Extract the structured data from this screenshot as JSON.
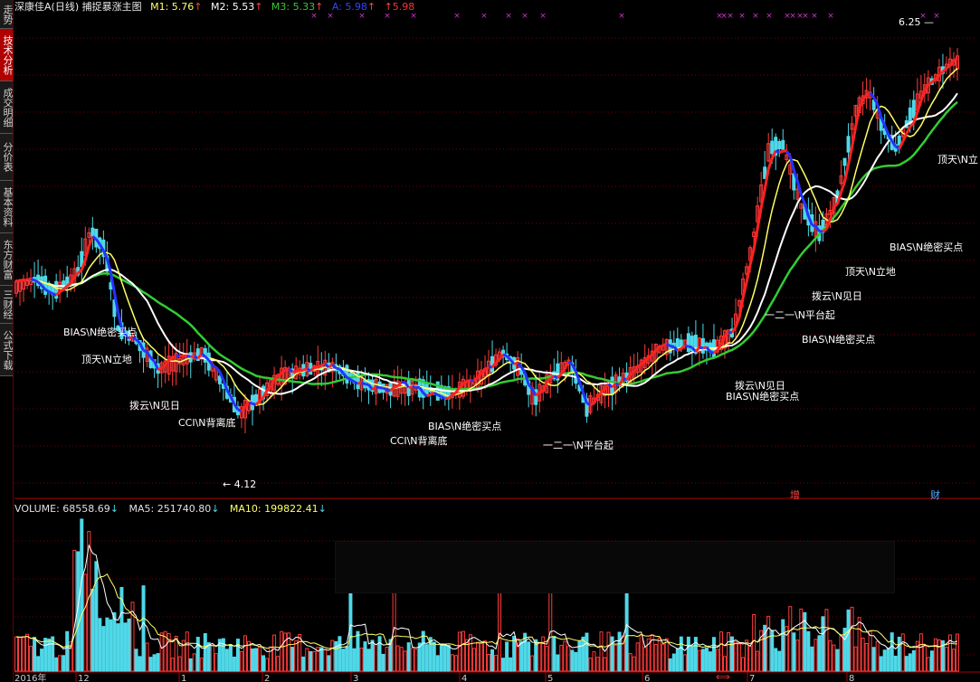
{
  "sidebar": {
    "tabs": [
      {
        "label": "走势",
        "active": false
      },
      {
        "label": "技术分析",
        "active": true
      },
      {
        "label": "成交明细",
        "active": false
      },
      {
        "label": "分价表",
        "active": false
      },
      {
        "label": "基本资料",
        "active": false
      },
      {
        "label": "东方财富",
        "active": false
      },
      {
        "label": "三财经",
        "active": false
      },
      {
        "label": "公式下载",
        "active": false
      }
    ]
  },
  "header": {
    "title": "深康佳A(日线) 捕捉暴涨主图",
    "m1": "M1: 5.76",
    "m2": "M2: 5.53",
    "m3": "M3: 5.33",
    "a": "A: 5.98",
    "b": "5.98",
    "arrow": "↑"
  },
  "volume_header": {
    "volume": "VOLUME: 68558.69",
    "ma5": "MA5: 251740.80",
    "ma10": "MA10: 199822.41",
    "arrow": "↓"
  },
  "colors": {
    "up": "#ff3b3b",
    "down": "#4fd8e8",
    "m1": "#ffff66",
    "m2": "#ffffff",
    "m3": "#33cc33",
    "signal": "#cc33cc",
    "grid": "#7a0000"
  },
  "chart_data": {
    "type": "candlestick",
    "price_range": [
      4.0,
      6.35
    ],
    "high_label": "6.25",
    "low_label": "4.12",
    "x_axis_labels": [
      "2016年",
      "12",
      "1",
      "2",
      "3",
      "4",
      "5",
      "6",
      "7",
      "8"
    ],
    "annotations": [
      "BIAS\\N绝密买点",
      "顶天\\N立地",
      "拨云\\N见日",
      "CCI\\N背离底",
      "CCI\\N背离底",
      "BIAS\\N绝密买点",
      "一二一\\N平台起",
      "一二一\\N平台起",
      "拨云\\N见日",
      "BIAS\\N绝密买点",
      "BIAS\\N绝密买点",
      "拨云\\N见日",
      "顶天\\N立地",
      "BIAS\\N绝密买点",
      "顶天\\N立"
    ],
    "markers": [
      "增",
      "财"
    ],
    "volume_axis_range": [
      0,
      1
    ]
  }
}
